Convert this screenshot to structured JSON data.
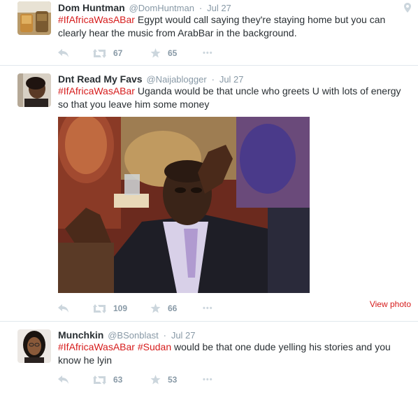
{
  "tweets": [
    {
      "fullname": "Dom Huntman",
      "username": "@DomHuntman",
      "separator": "·",
      "time": "Jul 27",
      "hashtag": "#IfAfricaWasABar",
      "text": " Egypt would call saying they're staying home but you can clearly hear the music from ArabBar in the background.",
      "retweets": "67",
      "favorites": "65",
      "more": "•••"
    },
    {
      "fullname": "Dnt Read My Favs",
      "username": "@Naijablogger",
      "separator": "·",
      "time": "Jul 27",
      "hashtag": "#IfAfricaWasABar",
      "text": " Uganda would be that uncle who greets U with lots of energy so that you leave him some money",
      "retweets": "109",
      "favorites": "66",
      "more": "•••",
      "view_photo": "View photo"
    },
    {
      "fullname": "Munchkin",
      "username": "@BSonblast",
      "separator": "·",
      "time": "Jul 27",
      "hashtag": "#IfAfricaWasABar",
      "hashtag2": "#Sudan",
      "text": " would be that one dude yelling his stories and you know he lyin",
      "retweets": "63",
      "favorites": "53",
      "more": "•••"
    }
  ],
  "colors": {
    "hashtag": "#d61c1c",
    "meta": "#8899a6",
    "text": "#292f33",
    "divider": "#e1e8ed"
  },
  "icons": [
    "reply-icon",
    "retweet-icon",
    "favorite-icon",
    "more-icon",
    "geo-pin-icon"
  ]
}
